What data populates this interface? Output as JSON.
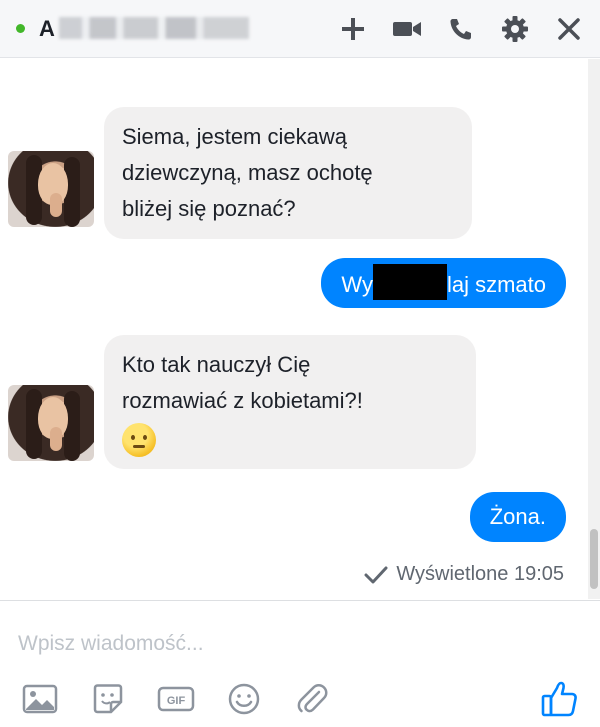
{
  "header": {
    "contact_name_visible": "A",
    "status": "online",
    "status_color": "#42b72a",
    "actions": [
      "add-icon",
      "video-call-icon",
      "phone-icon",
      "settings-icon",
      "close-icon"
    ],
    "icon_color": "#4b4f56"
  },
  "messages": [
    {
      "direction": "incoming",
      "text_lines": [
        "Siema, jestem ciekawą",
        "dziewczyną, masz ochotę",
        "bliżej się poznać?"
      ]
    },
    {
      "direction": "outgoing",
      "text_before_redaction": "Wy",
      "text_after_redaction": "laj szmato"
    },
    {
      "direction": "incoming",
      "text_lines": [
        "Kto tak nauczył Cię",
        "rozmawiać z kobietami?!"
      ],
      "emoji": "confused-face"
    },
    {
      "direction": "outgoing",
      "text": "Żona."
    }
  ],
  "seen_receipt": {
    "text": "Wyświetlone 19:05",
    "icon": "checkmark-icon"
  },
  "composer": {
    "placeholder": "Wpisz wiadomość...",
    "tools": [
      "photo-icon",
      "sticker-icon",
      "gif-icon",
      "emoji-icon",
      "attachment-icon"
    ],
    "send_button": "thumbs-up-icon",
    "accent_color": "#0084ff"
  },
  "colors": {
    "outgoing_bubble": "#0084ff",
    "incoming_bubble": "#f1f0f0"
  }
}
